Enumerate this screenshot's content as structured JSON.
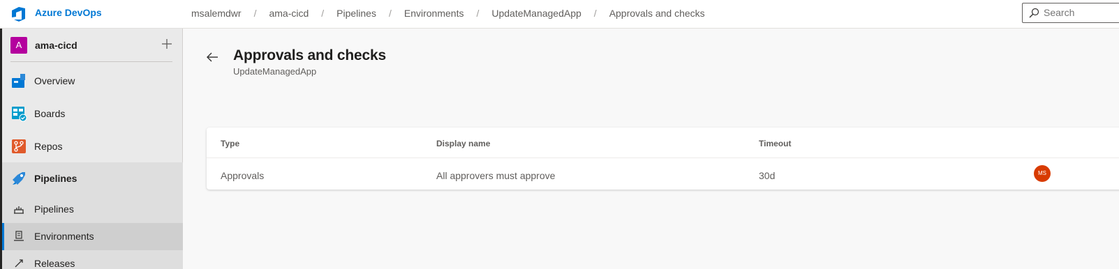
{
  "header": {
    "brand": "Azure DevOps",
    "breadcrumbs": [
      "msalemdwr",
      "ama-cicd",
      "Pipelines",
      "Environments",
      "UpdateManagedApp",
      "Approvals and checks"
    ],
    "breadcrumb_separator": "/",
    "search": {
      "placeholder": "Search",
      "icon": "search-icon"
    }
  },
  "sidebar": {
    "project": {
      "avatar_letter": "A",
      "name": "ama-cicd",
      "avatar_color": "#b4009e"
    },
    "items": [
      {
        "label": "Overview",
        "icon": "overview-icon"
      },
      {
        "label": "Boards",
        "icon": "boards-icon"
      },
      {
        "label": "Repos",
        "icon": "repos-icon"
      },
      {
        "label": "Pipelines",
        "icon": "pipelines-icon"
      }
    ],
    "sub_items": [
      {
        "label": "Pipelines",
        "icon": "pipeline-sub-icon"
      },
      {
        "label": "Environments",
        "icon": "environments-icon",
        "selected": true
      },
      {
        "label": "Releases",
        "icon": "releases-icon"
      }
    ]
  },
  "main": {
    "title": "Approvals and checks",
    "subtitle": "UpdateManagedApp",
    "table": {
      "columns": [
        "Type",
        "Display name",
        "Timeout"
      ],
      "rows": [
        {
          "type": "Approvals",
          "display_name": "All approvers must approve",
          "timeout": "30d",
          "user_initials": "MS"
        }
      ]
    }
  },
  "colors": {
    "accent": "#0078d4",
    "avatar": "#d83b01"
  }
}
